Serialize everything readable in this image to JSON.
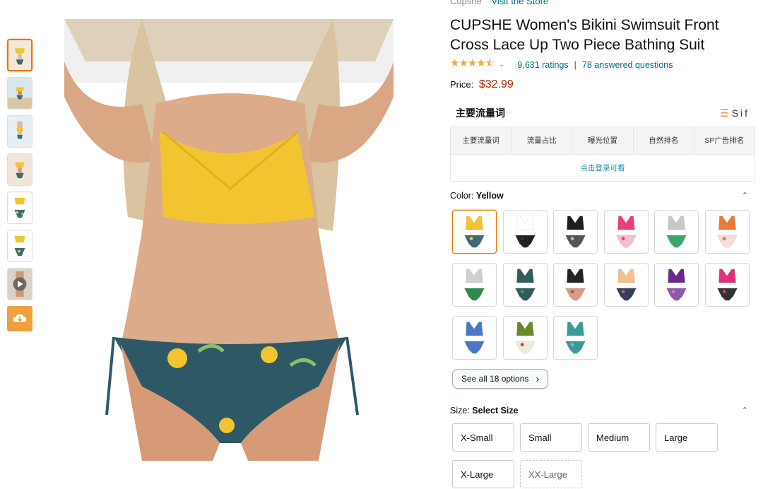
{
  "store": {
    "prefix": "Cupshe",
    "link": "Visit the Store"
  },
  "product": {
    "title": "CUPSHE Women's Bikini Swimsuit Front Cross Lace Up Two Piece Bathing Suit",
    "stars": "★★★★⯪",
    "rating_value": 4.5,
    "ratings_text": "9,631 ratings",
    "separator": "|",
    "questions_text": "78 answered questions",
    "price_label": "Price:",
    "price": "$32.99"
  },
  "traffic": {
    "title": "主要流量词",
    "brand": "Sif",
    "columns": [
      "主要流量词",
      "流量占比",
      "曝光位置",
      "自然排名",
      "SP广告排名"
    ],
    "login_text": "点击登录可看"
  },
  "color": {
    "label": "Color:",
    "selected": "Yellow",
    "swatches": [
      {
        "top": "#f2c530",
        "bottom": "#3c6b78",
        "accent": "#f2c530"
      },
      {
        "top": "#ffffff",
        "bottom": "#222222",
        "accent": "#333333"
      },
      {
        "top": "#1e1e1e",
        "bottom": "#555555",
        "accent": "#bbbbbb"
      },
      {
        "top": "#e8407a",
        "bottom": "#f2c0cc",
        "accent": "#e8407a"
      },
      {
        "top": "#c8c8c8",
        "bottom": "#3aa86a",
        "accent": "#3aa86a"
      },
      {
        "top": "#e87a3a",
        "bottom": "#f3dfd4",
        "accent": "#e87a3a"
      },
      {
        "top": "#d0d0d0",
        "bottom": "#2f8a4f",
        "accent": "#2f8a4f"
      },
      {
        "top": "#2f5f5a",
        "bottom": "#2f5f5a",
        "accent": "#4a8c84"
      },
      {
        "top": "#222222",
        "bottom": "#d99a8a",
        "accent": "#a85a4a"
      },
      {
        "top": "#f4c08e",
        "bottom": "#334055",
        "accent": "#c95a7a"
      },
      {
        "top": "#6a2a8a",
        "bottom": "#8a5ab0",
        "accent": "#d27ab0"
      },
      {
        "top": "#e0307a",
        "bottom": "#333333",
        "accent": "#e0307a"
      },
      {
        "top": "#4a78c4",
        "bottom": "#4a78c4",
        "accent": "#4a78c4"
      },
      {
        "top": "#6a8a2a",
        "bottom": "#f0ead8",
        "accent": "#c84a3a"
      },
      {
        "top": "#3a9a9a",
        "bottom": "#3a9a9a",
        "accent": "#7ac8c0"
      }
    ],
    "see_all": "See all 18 options",
    "see_all_chev": "›"
  },
  "size": {
    "label": "Size:",
    "selected": "Select Size",
    "options": [
      "X-Small",
      "Small",
      "Medium",
      "Large",
      "X-Large",
      "XX-Large"
    ]
  },
  "carets": {
    "up": "⌃"
  },
  "icons": {
    "play": "play-icon",
    "download": "cloud-download-icon"
  }
}
